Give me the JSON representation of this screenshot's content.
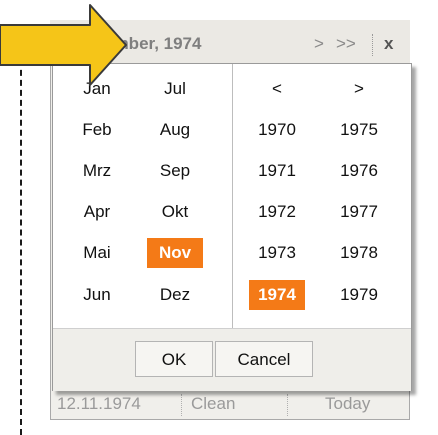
{
  "header": {
    "prev_year": "<<",
    "prev_month": "<",
    "title": "November, 1974",
    "next_month": ">",
    "next_year": ">>",
    "close": "x"
  },
  "months": {
    "col1": [
      "Jan",
      "Feb",
      "Mrz",
      "Apr",
      "Mai",
      "Jun"
    ],
    "col2": [
      "Jul",
      "Aug",
      "Sep",
      "Okt",
      "Nov",
      "Dez"
    ],
    "selected": "Nov"
  },
  "years": {
    "prev": "<",
    "next": ">",
    "col1": [
      "1970",
      "1971",
      "1972",
      "1973",
      "1974"
    ],
    "col2": [
      "1975",
      "1976",
      "1977",
      "1978",
      "1979"
    ],
    "selected": "1974"
  },
  "buttons": {
    "ok": "OK",
    "cancel": "Cancel"
  },
  "bottom_bar": {
    "date_value": "12.11.1974",
    "clean": "Clean",
    "today": "Today"
  },
  "colors": {
    "accent": "#f47a17",
    "arrow_fill": "#f5c518",
    "arrow_stroke": "#3a3a3a"
  },
  "icons": [
    "yellow-arrow-icon"
  ]
}
